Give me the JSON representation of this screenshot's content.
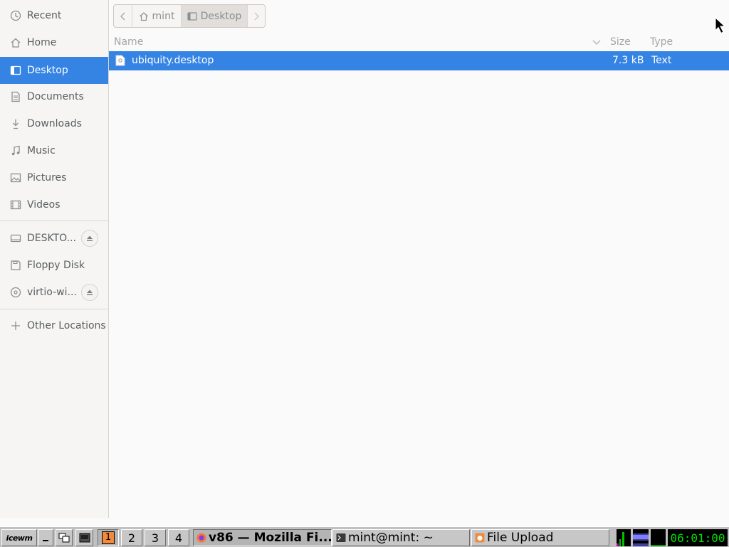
{
  "sidebar": {
    "items": [
      {
        "label": "Recent",
        "icon": "clock-icon"
      },
      {
        "label": "Home",
        "icon": "home-icon"
      },
      {
        "label": "Desktop",
        "icon": "desktop-icon",
        "selected": true
      },
      {
        "label": "Documents",
        "icon": "document-icon"
      },
      {
        "label": "Downloads",
        "icon": "download-icon"
      },
      {
        "label": "Music",
        "icon": "music-icon"
      },
      {
        "label": "Pictures",
        "icon": "picture-icon"
      },
      {
        "label": "Videos",
        "icon": "video-icon"
      }
    ],
    "devices": [
      {
        "label": "DESKTO...",
        "icon": "drive-icon",
        "eject": true
      },
      {
        "label": "Floppy Disk",
        "icon": "floppy-icon",
        "eject": false
      },
      {
        "label": "virtio-wi...",
        "icon": "optical-disc-icon",
        "eject": true
      }
    ],
    "other_locations": {
      "label": "Other Locations",
      "icon": "plus-icon"
    }
  },
  "pathbar": {
    "home_label": "mint",
    "current_label": "Desktop"
  },
  "file_list": {
    "columns": {
      "name": "Name",
      "size": "Size",
      "type": "Type"
    },
    "rows": [
      {
        "name": "ubiquity.desktop",
        "size": "7.3 kB",
        "type": "Text",
        "selected": true
      }
    ]
  },
  "taskbar": {
    "start_label": "icewm",
    "workspaces": [
      "1",
      "2",
      "3",
      "4"
    ],
    "active_workspace": "1",
    "tasks": [
      {
        "label": "v86 — Mozilla Fi...",
        "icon": "firefox-icon",
        "active": true
      },
      {
        "label": "mint@mint: ~",
        "icon": "terminal-icon",
        "active": false
      },
      {
        "label": "File Upload",
        "icon": "file-upload-icon",
        "active": false
      }
    ],
    "clock": "06:01:00"
  },
  "colors": {
    "selection": "#3584e4",
    "sidebar_bg": "#f6f5f4",
    "taskbar_bg": "#c0c0c0",
    "clock_fg": "#00e000"
  }
}
